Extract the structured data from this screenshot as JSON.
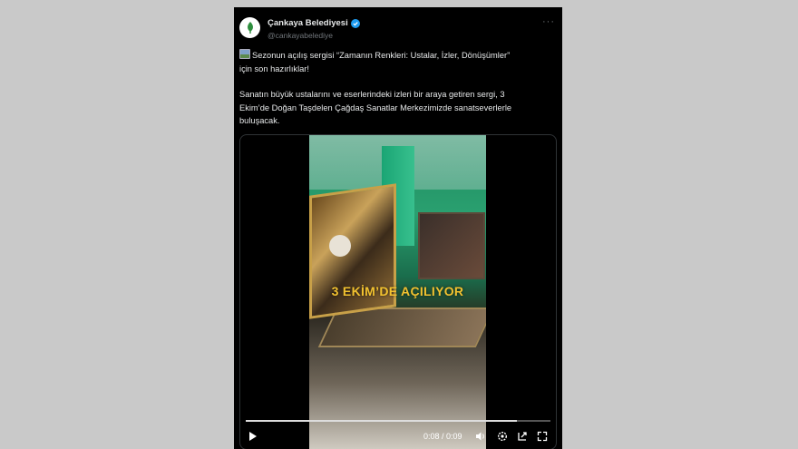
{
  "account": {
    "name": "Çankaya Belediyesi",
    "handle": "@cankayabelediye",
    "avatar_label": "Çankaya"
  },
  "post": {
    "line1": "Sezonun açılış sergisi “Zamanın Renkleri: Ustalar, İzler, Dönüşümler”",
    "line2": "için son hazırlıklar!",
    "line3": "Sanatın büyük ustalarını ve eserlerindeki izleri bir araya getiren sergi, 3",
    "line4": "Ekim’de Doğan Taşdelen Çağdaş Sanatlar Merkezimizde sanatseverlerle",
    "line5": "buluşacak."
  },
  "video": {
    "overlay_text": "3 EKİM’DE AÇILIYOR",
    "time": "0:08 / 0:09",
    "progress": 0.89
  },
  "icons": {
    "verified": "verified-badge-icon",
    "more": "more-options-icon",
    "play": "play-icon",
    "volume": "volume-icon",
    "settings": "settings-icon",
    "popout": "popout-icon",
    "fullscreen": "fullscreen-icon"
  },
  "colors": {
    "accent_verified": "#1d9bf0",
    "overlay_text": "#f2c230"
  }
}
